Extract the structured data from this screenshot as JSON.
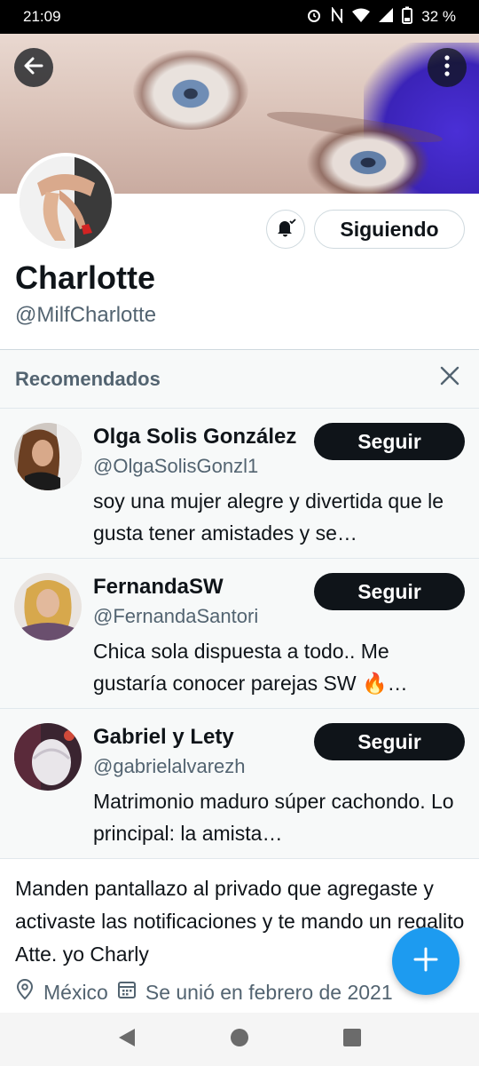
{
  "status_bar": {
    "time": "21:09",
    "battery": "32 %",
    "icons": [
      "alarm-icon",
      "nfc-icon",
      "wifi-icon",
      "signal-icon",
      "battery-icon"
    ]
  },
  "header": {
    "back_icon": "arrow-left-icon",
    "more_icon": "more-vertical-icon"
  },
  "profile": {
    "name": "Charlotte",
    "handle": "@MilfCharlotte",
    "follow_label": "Siguiendo",
    "notify_icon": "bell-check-icon",
    "bio": "Manden pantallazo al privado que agregaste y activaste las notificaciones y te mando un regalito Atte. yo Charly",
    "location": "México",
    "joined": "Se unió en febrero de 2021"
  },
  "recommended": {
    "title": "Recomendados",
    "close_icon": "close-icon",
    "items": [
      {
        "name": "Olga Solis González",
        "handle": "@OlgaSolisGonzl1",
        "bio": "soy una mujer alegre y divertida que le gusta tener amistades y se…",
        "follow_label": "Seguir"
      },
      {
        "name": "FernandaSW",
        "handle": "@FernandaSantori",
        "bio": "Chica sola dispuesta a todo.. Me gustaría conocer parejas SW 🔥…",
        "follow_label": "Seguir"
      },
      {
        "name": "Gabriel y Lety",
        "handle": "@gabrielalvarezh",
        "bio": "Matrimonio maduro súper cachondo. Lo principal: la amista…",
        "follow_label": "Seguir"
      }
    ]
  },
  "fab": {
    "icon": "plus-icon",
    "color": "#1d9bf0"
  },
  "nav": {
    "icons": [
      "back-triangle-icon",
      "home-circle-icon",
      "recents-square-icon"
    ]
  }
}
